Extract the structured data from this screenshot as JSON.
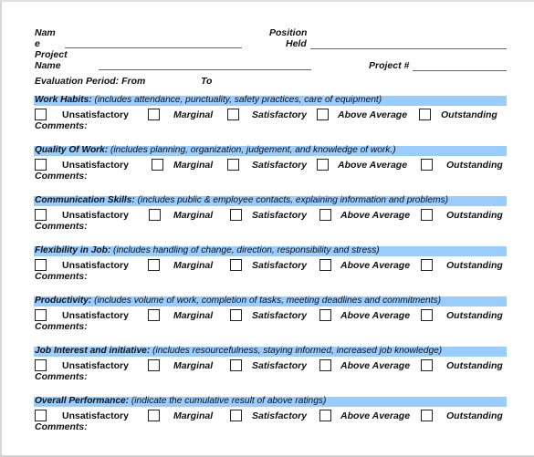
{
  "header": {
    "name_label_line1": "Nam",
    "name_label_line2": "e",
    "position_label_line1": "Position",
    "position_label_line2": "Held",
    "project_name_label_line1": "Project",
    "project_name_label_line2": "Name",
    "project_number_label": "Project #",
    "evaluation_period_label": "Evaluation Period:  From",
    "to_label": "To",
    "name_value": "",
    "position_value": "",
    "project_name_value": "",
    "project_number_value": ""
  },
  "rating_options": [
    "Unsatisfactory",
    "Marginal",
    "Satisfactory",
    "Above Average",
    "Outstanding"
  ],
  "comments_label": "Comments:",
  "sections": [
    {
      "title": "Work  Habits:",
      "description": " (includes attendance, punctuality, safety practices, care of equipment)"
    },
    {
      "title": "Quality Of Work:",
      "description": "  (includes planning, organization, judgement, and knowledge of work.)"
    },
    {
      "title": "Communication Skills:",
      "description": " (includes public & employee contacts, explaining information and problems)"
    },
    {
      "title": "Flexibility in Job:",
      "description": "  (includes handling of change, direction, responsibility and stress)"
    },
    {
      "title": "Productivity:",
      "description": "  (includes volume of work, completion of tasks, meeting deadlines and commitments)"
    },
    {
      "title": "Job Interest and initiative:",
      "description": "  (includes resourcefulness, staying informed, increased job knowledge)"
    },
    {
      "title": "Overall Performance:",
      "description": " (indicate the cumulative result of above ratings)"
    }
  ],
  "colors": {
    "band": "#99ccff"
  }
}
